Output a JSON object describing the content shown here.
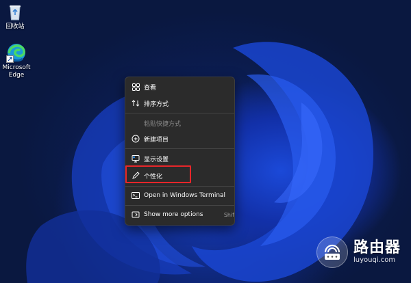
{
  "desktop": {
    "icons": [
      {
        "label": "回收站",
        "icon": "recycle-bin-icon"
      },
      {
        "label_line1": "Microsoft",
        "label_line2": "Edge",
        "icon": "edge-icon"
      }
    ]
  },
  "context_menu": {
    "items": [
      {
        "label": "查看",
        "icon": "grid-view-icon",
        "disabled": false
      },
      {
        "label": "排序方式",
        "icon": "sort-icon",
        "disabled": false
      },
      {
        "label": "粘贴快捷方式",
        "icon": "",
        "disabled": true
      },
      {
        "label": "新建项目",
        "icon": "plus-circle-icon",
        "disabled": false
      },
      {
        "label": "显示设置",
        "icon": "display-icon",
        "disabled": false
      },
      {
        "label": "个性化",
        "icon": "pen-icon",
        "disabled": false
      },
      {
        "label": "Open in Windows Terminal",
        "icon": "terminal-icon",
        "disabled": false
      },
      {
        "label": "Show more options",
        "icon": "more-options-icon",
        "disabled": false,
        "shortcut": "Shif"
      }
    ],
    "highlight_color": "#e8262a"
  },
  "watermark": {
    "cn": "路由器",
    "en": "luyouqi.com"
  },
  "colors": {
    "menu_bg": "#2b2b2b",
    "desktop_bg": "#0a1840",
    "accent_blue": "#1b49d8"
  }
}
